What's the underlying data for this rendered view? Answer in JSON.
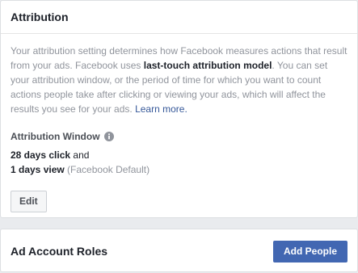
{
  "attribution": {
    "title": "Attribution",
    "description": {
      "part1": "Your attribution setting determines how Facebook measures actions that result from your ads. Facebook uses ",
      "bold": "last-touch attribution model",
      "part2": ". You can set your attribution window, or the period of time for which you want to count actions people take after clicking or viewing your ads, which will affect the results you see for your ads. ",
      "learn_more": "Learn more."
    },
    "window_label": "Attribution Window",
    "click_value": "28 days click",
    "click_suffix": " and",
    "view_value": "1 days view",
    "view_note": " (Facebook Default)",
    "edit_label": "Edit"
  },
  "roles": {
    "title": "Ad Account Roles",
    "add_people_label": "Add People"
  },
  "colors": {
    "accent": "#4267b2",
    "link": "#365899",
    "muted_text": "#90949c",
    "page_background": "#e9ebee"
  },
  "icons": {
    "info": "info-icon"
  }
}
